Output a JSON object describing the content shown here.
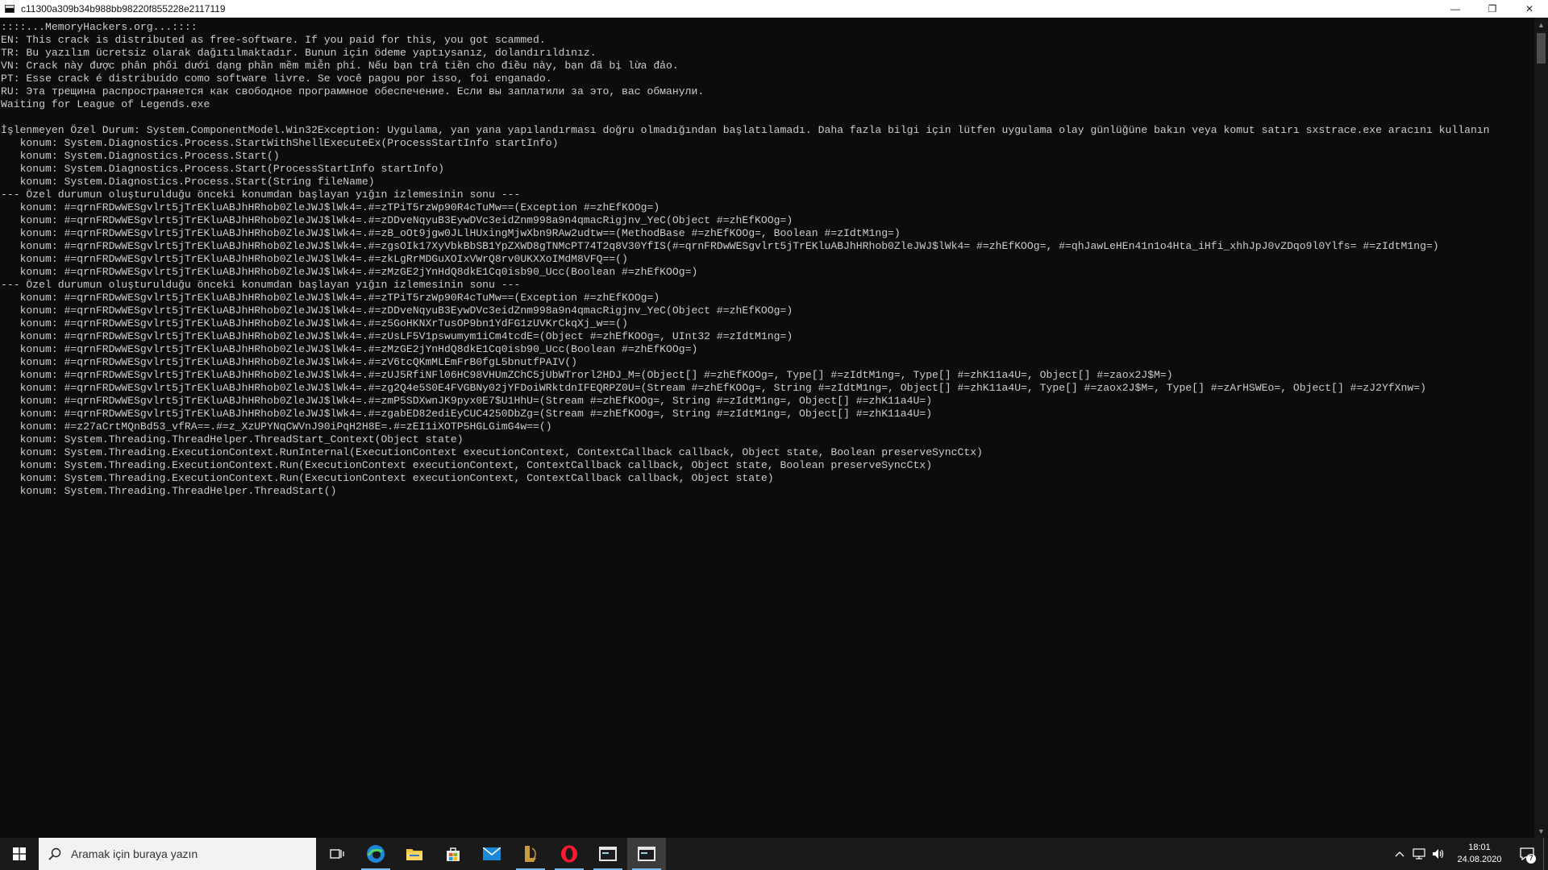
{
  "window": {
    "title": "c11300a309b34b988bb98220f855228e2117119",
    "minimize_glyph": "—",
    "restore_glyph": "❐",
    "close_glyph": "✕"
  },
  "console": {
    "lines": [
      "::::...MemoryHackers.org...::::",
      "EN: This crack is distributed as free-software. If you paid for this, you got scammed.",
      "TR: Bu yazılım ücretsiz olarak dağıtılmaktadır. Bunun için ödeme yaptıysanız, dolandırıldınız.",
      "VN: Crack này được phân phối dưới dạng phần mềm miễn phí. Nếu bạn trả tiền cho điều này, bạn đã bị lừa đảo.",
      "PT: Esse crack é distribuído como software livre. Se você pagou por isso, foi enganado.",
      "RU: Эта трещина распространяется как свободное программное обеспечение. Если вы заплатили за это, вас обманули.",
      "Waiting for League of Legends.exe",
      "",
      "İşlenmeyen Özel Durum: System.ComponentModel.Win32Exception: Uygulama, yan yana yapılandırması doğru olmadığından başlatılamadı. Daha fazla bilgi için lütfen uygulama olay günlüğüne bakın veya komut satırı sxstrace.exe aracını kullanın",
      "   konum: System.Diagnostics.Process.StartWithShellExecuteEx(ProcessStartInfo startInfo)",
      "   konum: System.Diagnostics.Process.Start()",
      "   konum: System.Diagnostics.Process.Start(ProcessStartInfo startInfo)",
      "   konum: System.Diagnostics.Process.Start(String fileName)",
      "--- Özel durumun oluşturulduğu önceki konumdan başlayan yığın izlemesinin sonu ---",
      "   konum: #=qrnFRDwWESgvlrt5jTrEKluABJhHRhob0ZleJWJ$lWk4=.#=zTPiT5rzWp90R4cTuMw==(Exception #=zhEfKOOg=)",
      "   konum: #=qrnFRDwWESgvlrt5jTrEKluABJhHRhob0ZleJWJ$lWk4=.#=zDDveNqyuB3EywDVc3eidZnm998a9n4qmacRigjnv_YeC(Object #=zhEfKOOg=)",
      "   konum: #=qrnFRDwWESgvlrt5jTrEKluABJhHRhob0ZleJWJ$lWk4=.#=zB_oOt9jgw0JLlHUxingMjwXbn9RAw2udtw==(MethodBase #=zhEfKOOg=, Boolean #=zIdtM1ng=)",
      "   konum: #=qrnFRDwWESgvlrt5jTrEKluABJhHRhob0ZleJWJ$lWk4=.#=zgsOIk17XyVbkBbSB1YpZXWD8gTNMcPT74T2q8V30YfIS(#=qrnFRDwWESgvlrt5jTrEKluABJhHRhob0ZleJWJ$lWk4= #=zhEfKOOg=, #=qhJawLeHEn41n1o4Hta_iHfi_xhhJpJ0vZDqo9l0Ylfs= #=zIdtM1ng=)",
      "   konum: #=qrnFRDwWESgvlrt5jTrEKluABJhHRhob0ZleJWJ$lWk4=.#=zkLgRrMDGuXOIxVWrQ8rv0UKXXoIMdM8VFQ==()",
      "   konum: #=qrnFRDwWESgvlrt5jTrEKluABJhHRhob0ZleJWJ$lWk4=.#=zMzGE2jYnHdQ8dkE1Cq0isb90_Ucc(Boolean #=zhEfKOOg=)",
      "--- Özel durumun oluşturulduğu önceki konumdan başlayan yığın izlemesinin sonu ---",
      "   konum: #=qrnFRDwWESgvlrt5jTrEKluABJhHRhob0ZleJWJ$lWk4=.#=zTPiT5rzWp90R4cTuMw==(Exception #=zhEfKOOg=)",
      "   konum: #=qrnFRDwWESgvlrt5jTrEKluABJhHRhob0ZleJWJ$lWk4=.#=zDDveNqyuB3EywDVc3eidZnm998a9n4qmacRigjnv_YeC(Object #=zhEfKOOg=)",
      "   konum: #=qrnFRDwWESgvlrt5jTrEKluABJhHRhob0ZleJWJ$lWk4=.#=z5GoHKNXrTusOP9bn1YdFG1zUVKrCkqXj_w==()",
      "   konum: #=qrnFRDwWESgvlrt5jTrEKluABJhHRhob0ZleJWJ$lWk4=.#=zUsLF5V1pswumym1iCm4tcdE=(Object #=zhEfKOOg=, UInt32 #=zIdtM1ng=)",
      "   konum: #=qrnFRDwWESgvlrt5jTrEKluABJhHRhob0ZleJWJ$lWk4=.#=zMzGE2jYnHdQ8dkE1Cq0isb90_Ucc(Boolean #=zhEfKOOg=)",
      "   konum: #=qrnFRDwWESgvlrt5jTrEKluABJhHRhob0ZleJWJ$lWk4=.#=zV6tcQKmMLEmFrB0fgL5bnutfPAIV()",
      "   konum: #=qrnFRDwWESgvlrt5jTrEKluABJhHRhob0ZleJWJ$lWk4=.#=zUJ5RfiNFl06HC98VHUmZChC5jUbWTrorl2HDJ_M=(Object[] #=zhEfKOOg=, Type[] #=zIdtM1ng=, Type[] #=zhK11a4U=, Object[] #=zaox2J$M=)",
      "   konum: #=qrnFRDwWESgvlrt5jTrEKluABJhHRhob0ZleJWJ$lWk4=.#=zg2Q4e5S0E4FVGBNy02jYFDoiWRktdnIFEQRPZ0U=(Stream #=zhEfKOOg=, String #=zIdtM1ng=, Object[] #=zhK11a4U=, Type[] #=zaox2J$M=, Type[] #=zArHSWEo=, Object[] #=zJ2YfXnw=)",
      "   konum: #=qrnFRDwWESgvlrt5jTrEKluABJhHRhob0ZleJWJ$lWk4=.#=zmP5SDXwnJK9pyx0E7$U1HhU=(Stream #=zhEfKOOg=, String #=zIdtM1ng=, Object[] #=zhK11a4U=)",
      "   konum: #=qrnFRDwWESgvlrt5jTrEKluABJhHRhob0ZleJWJ$lWk4=.#=zgabED82ediEyCUC4250DbZg=(Stream #=zhEfKOOg=, String #=zIdtM1ng=, Object[] #=zhK11a4U=)",
      "   konum: #=z27aCrtMQnBd53_vfRA==.#=z_XzUPYNqCWVnJ90iPqH2H8E=.#=zEI1iXOTP5HGLGimG4w==()",
      "   konum: System.Threading.ThreadHelper.ThreadStart_Context(Object state)",
      "   konum: System.Threading.ExecutionContext.RunInternal(ExecutionContext executionContext, ContextCallback callback, Object state, Boolean preserveSyncCtx)",
      "   konum: System.Threading.ExecutionContext.Run(ExecutionContext executionContext, ContextCallback callback, Object state, Boolean preserveSyncCtx)",
      "   konum: System.Threading.ExecutionContext.Run(ExecutionContext executionContext, ContextCallback callback, Object state)",
      "   konum: System.Threading.ThreadHelper.ThreadStart()"
    ]
  },
  "taskbar": {
    "search_placeholder": "Aramak için buraya yazın",
    "apps": [
      "task-view-icon",
      "edge-icon",
      "file-explorer-icon",
      "store-icon",
      "mail-icon",
      "league-of-legends-icon",
      "opera-icon",
      "console-icon",
      "console-active-icon"
    ],
    "clock_time": "18:01",
    "clock_date": "24.08.2020",
    "notification_count": "7",
    "accent_color": "#76b9ed"
  }
}
